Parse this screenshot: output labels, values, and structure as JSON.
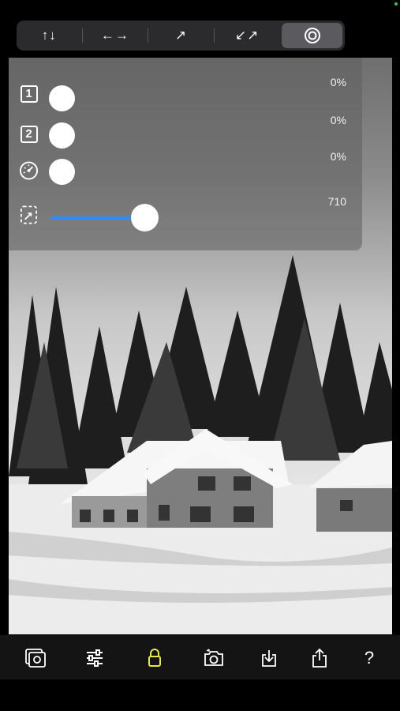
{
  "toolbar_top": {
    "buttons": [
      {
        "glyph": "↑↓",
        "icon": "vertical-flip-icon",
        "selected": false
      },
      {
        "glyph": "←→",
        "icon": "horizontal-flip-icon",
        "selected": false
      },
      {
        "glyph": "↗",
        "icon": "diagonal-arrow-icon",
        "selected": false
      },
      {
        "glyph": "↙↗",
        "icon": "diagonal-both-icon",
        "selected": false
      },
      {
        "glyph": "◎",
        "icon": "target-icon",
        "selected": true
      }
    ]
  },
  "panel": {
    "row1": {
      "badge": "1",
      "value": "0%"
    },
    "row2": {
      "badge": "2",
      "value": "0%"
    },
    "row3": {
      "icon": "speedometer-icon",
      "value": "0%"
    },
    "slider": {
      "icon": "resize-icon",
      "value": "710",
      "level": 0.7
    }
  },
  "bottom_toolbar": [
    "photo-library-icon",
    "sliders-icon",
    "lock-icon",
    "camera-flip-icon",
    "download-icon",
    "share-icon",
    "help-icon"
  ],
  "help_glyph": "?",
  "colors": {
    "accent": "#2b8cff",
    "lock": "#e6e84a",
    "background": "#000000"
  }
}
